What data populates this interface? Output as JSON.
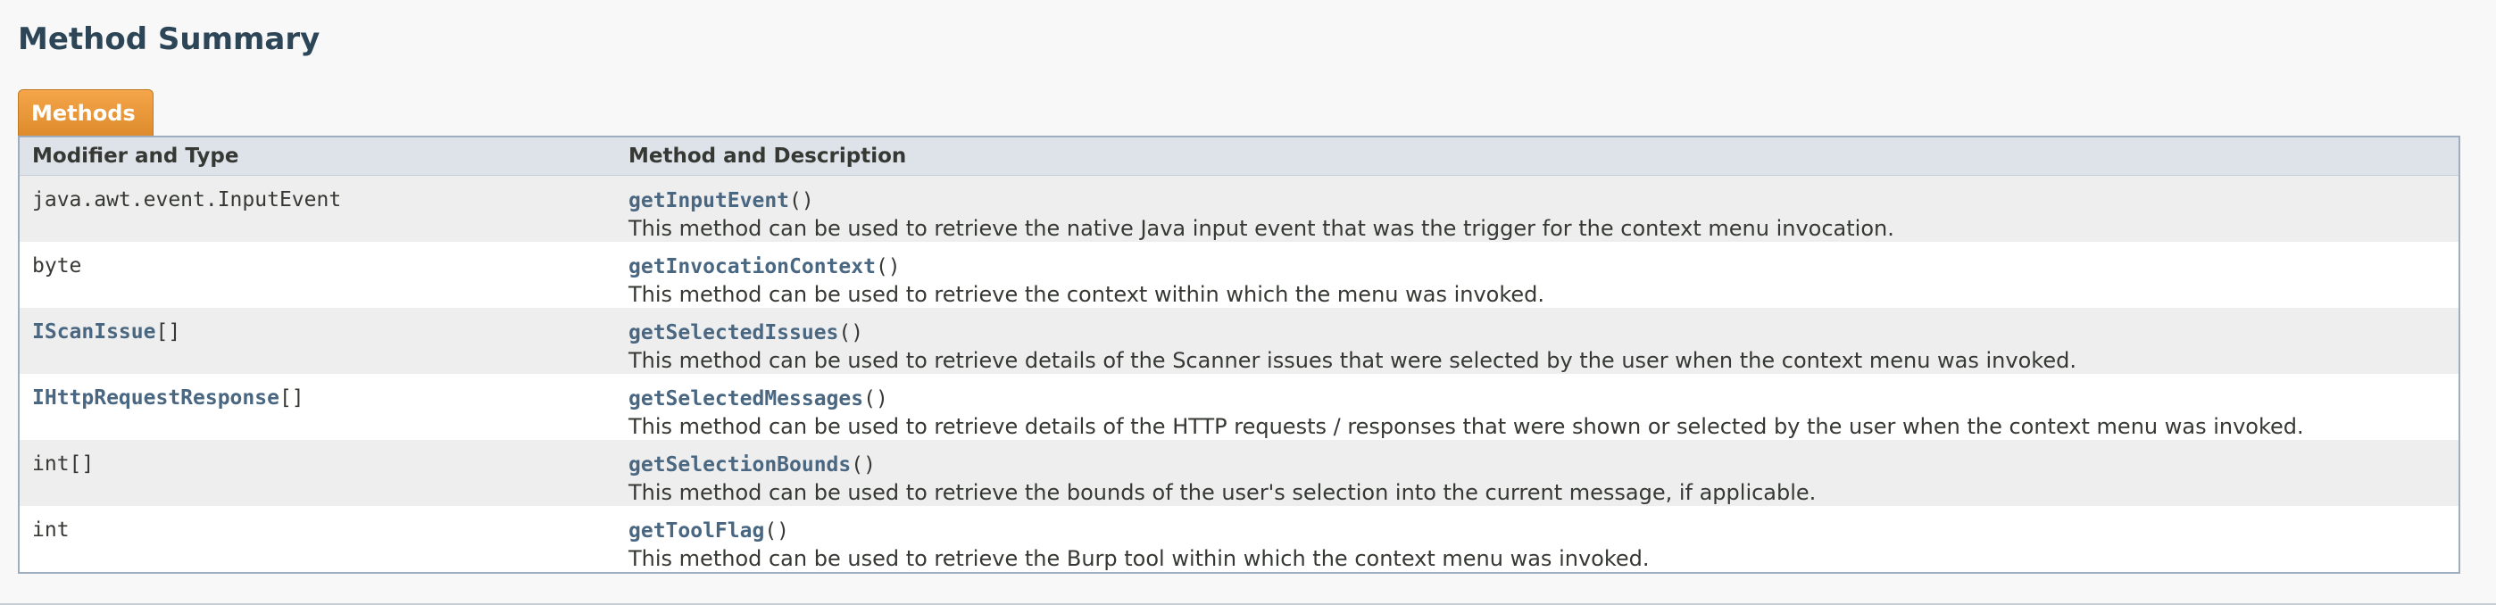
{
  "section": {
    "title": "Method Summary",
    "tab_label": "Methods"
  },
  "table": {
    "headers": [
      "Modifier and Type",
      "Method and Description"
    ],
    "rows": [
      {
        "type": "java.awt.event.InputEvent",
        "type_is_link": false,
        "type_suffix": "",
        "method": "getInputEvent",
        "params": "()",
        "description": "This method can be used to retrieve the native Java input event that was the trigger for the context menu invocation."
      },
      {
        "type": "byte",
        "type_is_link": false,
        "type_suffix": "",
        "method": "getInvocationContext",
        "params": "()",
        "description": "This method can be used to retrieve the context within which the menu was invoked."
      },
      {
        "type": "IScanIssue",
        "type_is_link": true,
        "type_suffix": "[]",
        "method": "getSelectedIssues",
        "params": "()",
        "description": "This method can be used to retrieve details of the Scanner issues that were selected by the user when the context menu was invoked."
      },
      {
        "type": "IHttpRequestResponse",
        "type_is_link": true,
        "type_suffix": "[]",
        "method": "getSelectedMessages",
        "params": "()",
        "description": "This method can be used to retrieve details of the HTTP requests / responses that were shown or selected by the user when the context menu was invoked."
      },
      {
        "type": "int[]",
        "type_is_link": false,
        "type_suffix": "",
        "method": "getSelectionBounds",
        "params": "()",
        "description": "This method can be used to retrieve the bounds of the user's selection into the current message, if applicable."
      },
      {
        "type": "int",
        "type_is_link": false,
        "type_suffix": "",
        "method": "getToolFlag",
        "params": "()",
        "description": "This method can be used to retrieve the Burp tool within which the context menu was invoked."
      }
    ]
  },
  "colors": {
    "tab_orange": "#dd8b2c",
    "header_bg": "#dee3e9",
    "link": "#4a6782",
    "alt_row": "#eeeeef"
  }
}
